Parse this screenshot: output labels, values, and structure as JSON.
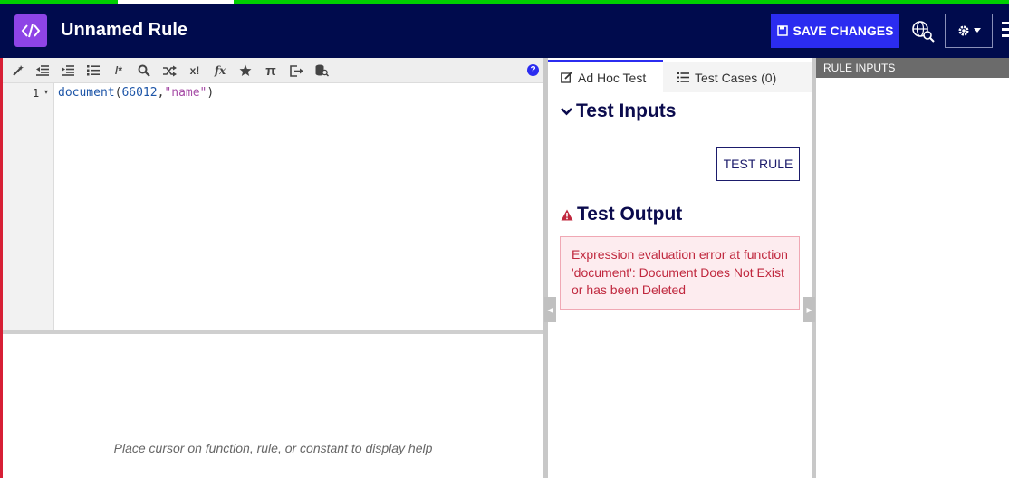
{
  "header": {
    "title": "Unnamed Rule",
    "save_label": "SAVE CHANGES"
  },
  "toolbar": {
    "icons": [
      "magic-wand-icon",
      "outdent-icon",
      "indent-icon",
      "list-icon",
      "comment-icon",
      "search-icon",
      "shuffle-icon",
      "factorial-icon",
      "function-icon",
      "star-icon",
      "pi-icon",
      "export-icon",
      "database-search-icon"
    ],
    "comment_glyph": "/*",
    "factorial_glyph": "x!",
    "function_glyph": "fx",
    "pi_glyph": "π",
    "help_glyph": "?"
  },
  "editor": {
    "line_number": "1",
    "code": {
      "fn": "document",
      "open": "(",
      "num": "66012",
      "comma": ",",
      "str": "\"name\"",
      "close": ")"
    },
    "help_text": "Place cursor on function, rule, or constant to display help"
  },
  "test_panel": {
    "tabs": [
      {
        "label": "Ad Hoc Test",
        "active": true
      },
      {
        "label": "Test Cases (0)",
        "active": false
      }
    ],
    "inputs_title": "Test Inputs",
    "test_button": "TEST RULE",
    "output_title": "Test Output",
    "error_message": "Expression evaluation error at function 'document': Document Does Not Exist or has been Deleted"
  },
  "rule_inputs": {
    "title": "RULE INPUTS"
  },
  "colors": {
    "header_bg": "#000b4d",
    "accent": "#2b2cf0",
    "logo_bg": "#8e44e6",
    "error_text": "#c0283e",
    "error_bg": "#fdecef"
  }
}
